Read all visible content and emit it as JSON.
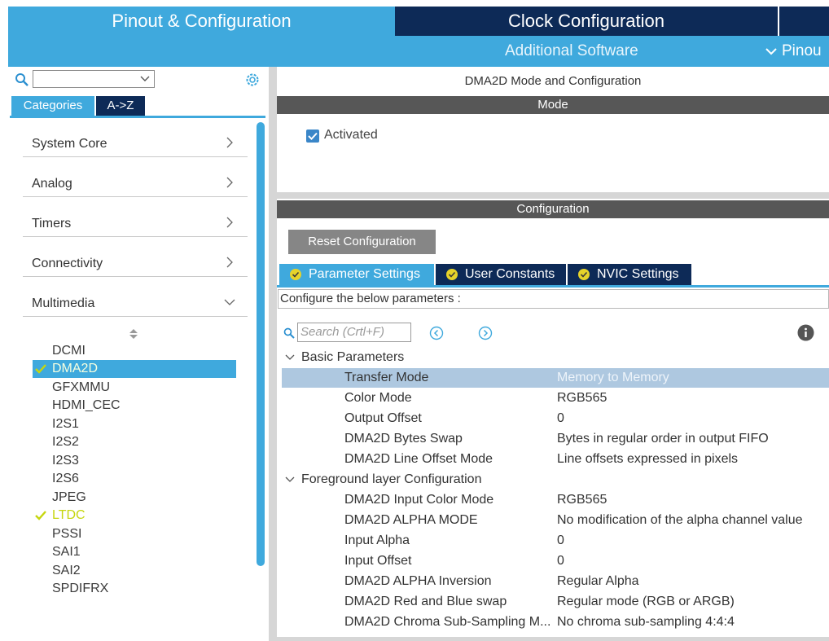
{
  "header": {
    "tab_pinout": "Pinout & Configuration",
    "tab_clock": "Clock Configuration",
    "additional_software": "Additional Software",
    "pinout_menu": "Pinou"
  },
  "sidebar": {
    "search_placeholder": "",
    "tab_categories": "Categories",
    "tab_az": "A->Z",
    "categories": [
      {
        "label": "System Core",
        "expanded": false
      },
      {
        "label": "Analog",
        "expanded": false
      },
      {
        "label": "Timers",
        "expanded": false
      },
      {
        "label": "Connectivity",
        "expanded": false
      },
      {
        "label": "Multimedia",
        "expanded": true
      }
    ],
    "peripherals": [
      {
        "label": "DCMI",
        "state": "none"
      },
      {
        "label": "DMA2D",
        "state": "selected"
      },
      {
        "label": "GFXMMU",
        "state": "none"
      },
      {
        "label": "HDMI_CEC",
        "state": "none"
      },
      {
        "label": "I2S1",
        "state": "none"
      },
      {
        "label": "I2S2",
        "state": "none"
      },
      {
        "label": "I2S3",
        "state": "none"
      },
      {
        "label": "I2S6",
        "state": "none"
      },
      {
        "label": "JPEG",
        "state": "none"
      },
      {
        "label": "LTDC",
        "state": "enabled"
      },
      {
        "label": "PSSI",
        "state": "none"
      },
      {
        "label": "SAI1",
        "state": "none"
      },
      {
        "label": "SAI2",
        "state": "none"
      },
      {
        "label": "SPDIFRX",
        "state": "none"
      }
    ]
  },
  "main": {
    "title": "DMA2D Mode and Configuration",
    "mode_header": "Mode",
    "activated_label": "Activated",
    "activated_checked": true,
    "config_header": "Configuration",
    "reset_button": "Reset Configuration",
    "tabs": [
      {
        "label": "Parameter Settings",
        "active": true
      },
      {
        "label": "User Constants",
        "active": false
      },
      {
        "label": "NVIC Settings",
        "active": false
      }
    ],
    "configure_text": "Configure the below parameters :",
    "search_placeholder": "Search (Crtl+F)",
    "groups": [
      {
        "label": "Basic Parameters",
        "rows": [
          {
            "name": "Transfer Mode",
            "value": "Memory to Memory",
            "selected": true
          },
          {
            "name": "Color Mode",
            "value": "RGB565",
            "selected": false
          },
          {
            "name": "Output Offset",
            "value": "0",
            "selected": false
          },
          {
            "name": "DMA2D Bytes Swap",
            "value": "Bytes in regular order in output FIFO",
            "selected": false
          },
          {
            "name": "DMA2D Line Offset Mode",
            "value": "Line offsets expressed in pixels",
            "selected": false
          }
        ]
      },
      {
        "label": "Foreground layer Configuration",
        "rows": [
          {
            "name": "DMA2D Input Color Mode",
            "value": "RGB565",
            "selected": false
          },
          {
            "name": "DMA2D ALPHA MODE",
            "value": "No modification of the alpha channel value",
            "selected": false
          },
          {
            "name": "Input Alpha",
            "value": "0",
            "selected": false
          },
          {
            "name": "Input Offset",
            "value": "0",
            "selected": false
          },
          {
            "name": "DMA2D ALPHA Inversion",
            "value": "Regular Alpha",
            "selected": false
          },
          {
            "name": "DMA2D Red and Blue swap",
            "value": "Regular mode (RGB or ARGB)",
            "selected": false
          },
          {
            "name": "DMA2D Chroma Sub-Sampling M...",
            "value": "No chroma sub-sampling 4:4:4",
            "selected": false
          }
        ]
      }
    ]
  },
  "colors": {
    "accent_light": "#3fa9dd",
    "accent_dark": "#0d2a57",
    "section_bar": "#575757",
    "enabled_green": "#c6d60e",
    "row_selected": "#aec8e0"
  }
}
